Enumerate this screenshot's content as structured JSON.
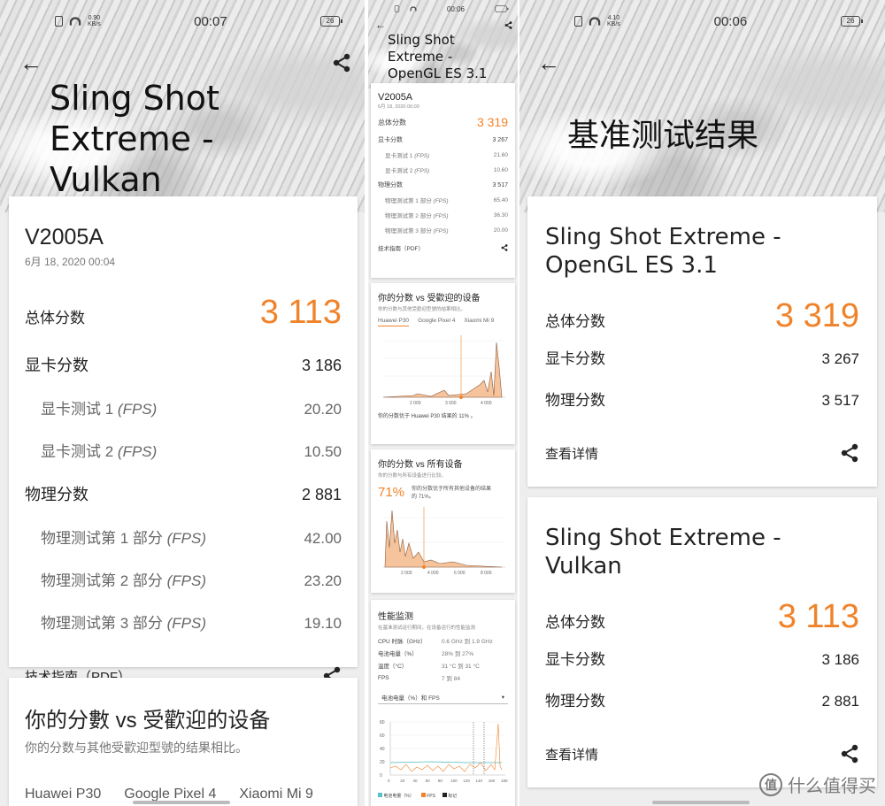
{
  "colors": {
    "accent": "#f0832a",
    "card": "#ffffff",
    "text": "#222222"
  },
  "phone1": {
    "status": {
      "time": "00:07",
      "speed_value": "0.90",
      "speed_unit": "KB/s",
      "battery": "26"
    },
    "hero_title": [
      "Sling Shot",
      "Extreme -",
      "Vulkan"
    ],
    "device_name": "V2005A",
    "device_date": "6月 18, 2020 00:04",
    "total_label": "总体分数",
    "total_value": "3 113",
    "rows": [
      {
        "label": "显卡分数",
        "value": "3 186",
        "indent": false
      },
      {
        "label": "显卡测试 1",
        "fps": "(FPS)",
        "value": "20.20",
        "indent": true
      },
      {
        "label": "显卡测试 2",
        "fps": "(FPS)",
        "value": "10.50",
        "indent": true
      },
      {
        "label": "物理分数",
        "value": "2 881",
        "indent": false
      },
      {
        "label": "物理测试第 1 部分",
        "fps": "(FPS)",
        "value": "42.00",
        "indent": true
      },
      {
        "label": "物理测试第 2 部分",
        "fps": "(FPS)",
        "value": "23.20",
        "indent": true
      },
      {
        "label": "物理测试第 3 部分",
        "fps": "(FPS)",
        "value": "19.10",
        "indent": true
      }
    ],
    "tech_guide": "技术指南（PDF）",
    "compare_title": "你的分數 vs 受歡迎的设备",
    "compare_sub": "你的分数与其他受歡迎型號的结果相比。",
    "compare_tabs": [
      "Huawei P30",
      "Google Pixel 4",
      "Xiaomi Mi 9"
    ]
  },
  "phone2": {
    "status": {
      "time": "00:06"
    },
    "hero_title": [
      "Sling Shot",
      "Extreme -",
      "OpenGL ES 3.1"
    ],
    "device_name": "V2005A",
    "device_date": "6月 18, 2020 00:00",
    "total_label": "总体分数",
    "total_value": "3 319",
    "rows": [
      {
        "label": "显卡分数",
        "value": "3 267",
        "indent": false
      },
      {
        "label": "显卡测试 1",
        "fps": "(FPS)",
        "value": "21.60",
        "indent": true
      },
      {
        "label": "显卡测试 2",
        "fps": "(FPS)",
        "value": "10.60",
        "indent": true
      },
      {
        "label": "物理分数",
        "value": "3 517",
        "indent": false
      },
      {
        "label": "物理测试第 1 部分",
        "fps": "(FPS)",
        "value": "65.40",
        "indent": true
      },
      {
        "label": "物理测试第 2 部分",
        "fps": "(FPS)",
        "value": "36.30",
        "indent": true
      },
      {
        "label": "物理测试第 3 部分",
        "fps": "(FPS)",
        "value": "20.00",
        "indent": true
      }
    ],
    "tech_guide": "技术指南（PDF）",
    "popular": {
      "title": "你的分数 vs 受歡迎的设备",
      "sub": "你的分数与其他受歡迎型號的结果相比。",
      "tabs": [
        "Huawei P30",
        "Google Pixel 4",
        "Xiaomi Mi 9"
      ],
      "x_ticks": [
        "2 000",
        "3 000",
        "4 000"
      ],
      "footer": "你的分数优于 Huawei P30 结果的 11% 。"
    },
    "all": {
      "title": "你的分数 vs 所有设备",
      "sub": "你的分数与所有设备进行比较。",
      "percent": "71%",
      "desc": "你的分数优于所有其他设备的结果的 71%。",
      "x_ticks": [
        "2 000",
        "4 000",
        "6 000",
        "8 000"
      ]
    },
    "monitor": {
      "title": "性能监测",
      "sub": "在基准测试运行期间，在设备运行的性能监测",
      "rows": [
        {
          "label": "CPU 时脉（GHz）",
          "value": "0.6 GHz 到 1.9 GHz"
        },
        {
          "label": "电池电量（%）",
          "value": "28% 到 27%"
        },
        {
          "label": "温度（°C）",
          "value": "31 °C 到 31 °C"
        },
        {
          "label": "FPS",
          "value": "7 到 84"
        }
      ],
      "dropdown": "电池电量（%）和 FPS",
      "y_ticks": [
        "80",
        "60",
        "40",
        "20",
        "0"
      ],
      "x_ticks": [
        "0",
        "20",
        "40",
        "60",
        "80",
        "100",
        "120",
        "140",
        "160",
        "180"
      ],
      "legend": [
        "电池电量（%）",
        "FPS",
        "标记"
      ]
    }
  },
  "phone3": {
    "status": {
      "time": "00:06",
      "speed_value": "4.10",
      "speed_unit": "KB/s",
      "battery": "26"
    },
    "hero_title": "基准测试结果",
    "results": [
      {
        "title": [
          "Sling Shot Extreme -",
          "OpenGL ES 3.1"
        ],
        "total_label": "总体分数",
        "total_value": "3 319",
        "gpu_label": "显卡分数",
        "gpu_value": "3 267",
        "phys_label": "物理分数",
        "phys_value": "3 517",
        "details": "查看详情"
      },
      {
        "title": [
          "Sling Shot Extreme -",
          "Vulkan"
        ],
        "total_label": "总体分数",
        "total_value": "3 113",
        "gpu_label": "显卡分数",
        "gpu_value": "3 186",
        "phys_label": "物理分数",
        "phys_value": "2 881",
        "details": "查看详情"
      }
    ],
    "watermark_logo": "值",
    "watermark_text": "什么值得买"
  }
}
